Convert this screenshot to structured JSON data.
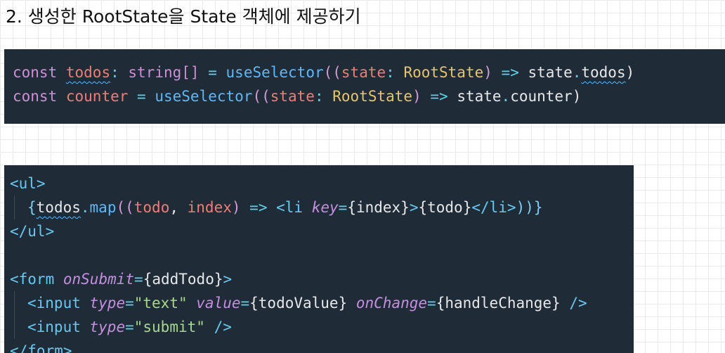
{
  "heading": "2. 생성한 RootState을 State 객체에 제공하기",
  "code1": {
    "l1": {
      "const": "const",
      "todos": "todos",
      "colon": ":",
      "type": "string[]",
      "eq": "=",
      "fn": "useSelector",
      "open": "((",
      "param": "state",
      "colon2": ":",
      "rootstate": "RootState",
      "close": ")",
      "arrow": "=>",
      "obj": "state",
      "dot": ".",
      "prop": "todos",
      "end": ")"
    },
    "l2": {
      "const": "const",
      "counter": "counter",
      "eq": "=",
      "fn": "useSelector",
      "open": "((",
      "param": "state",
      "colon": ":",
      "rootstate": "RootState",
      "close": ")",
      "arrow": "=>",
      "obj": "state",
      "dot": ".",
      "prop": "counter",
      "end": ")"
    }
  },
  "code2": {
    "ul_open": "<ul>",
    "map": {
      "brace": "{",
      "todos": "todos",
      "dot": ".",
      "map": "map",
      "open": "((",
      "todo": "todo",
      "comma": ", ",
      "index": "index",
      "close": ")",
      "arrow": "=>",
      "li_open": "<li",
      "key_attr": "key",
      "eq": "=",
      "key_val": "{index}",
      "gt": ">",
      "todo_expr": "{todo}",
      "li_close": "</li>",
      "end": "))}"
    },
    "ul_close": "</ul>",
    "form_open": "<form",
    "onsubmit_attr": "onSubmit",
    "eq": "=",
    "onsubmit_val": "{addTodo}",
    "gt": ">",
    "input1": {
      "tag": "<input",
      "type_attr": "type",
      "type_val": "\"text\"",
      "value_attr": "value",
      "value_val": "{todoValue}",
      "onchange_attr": "onChange",
      "onchange_val": "{handleChange}",
      "end": "/>"
    },
    "input2": {
      "tag": "<input",
      "type_attr": "type",
      "type_val": "\"submit\"",
      "end": "/>"
    },
    "form_close": "</form>"
  },
  "colors": {
    "code_background": "#1f2b36",
    "keyword": "#cd8fd6",
    "variable": "#f47c76",
    "function": "#5cb9ff",
    "type": "#e8c46b",
    "tag": "#67c9f3",
    "string": "#a6d98a"
  }
}
